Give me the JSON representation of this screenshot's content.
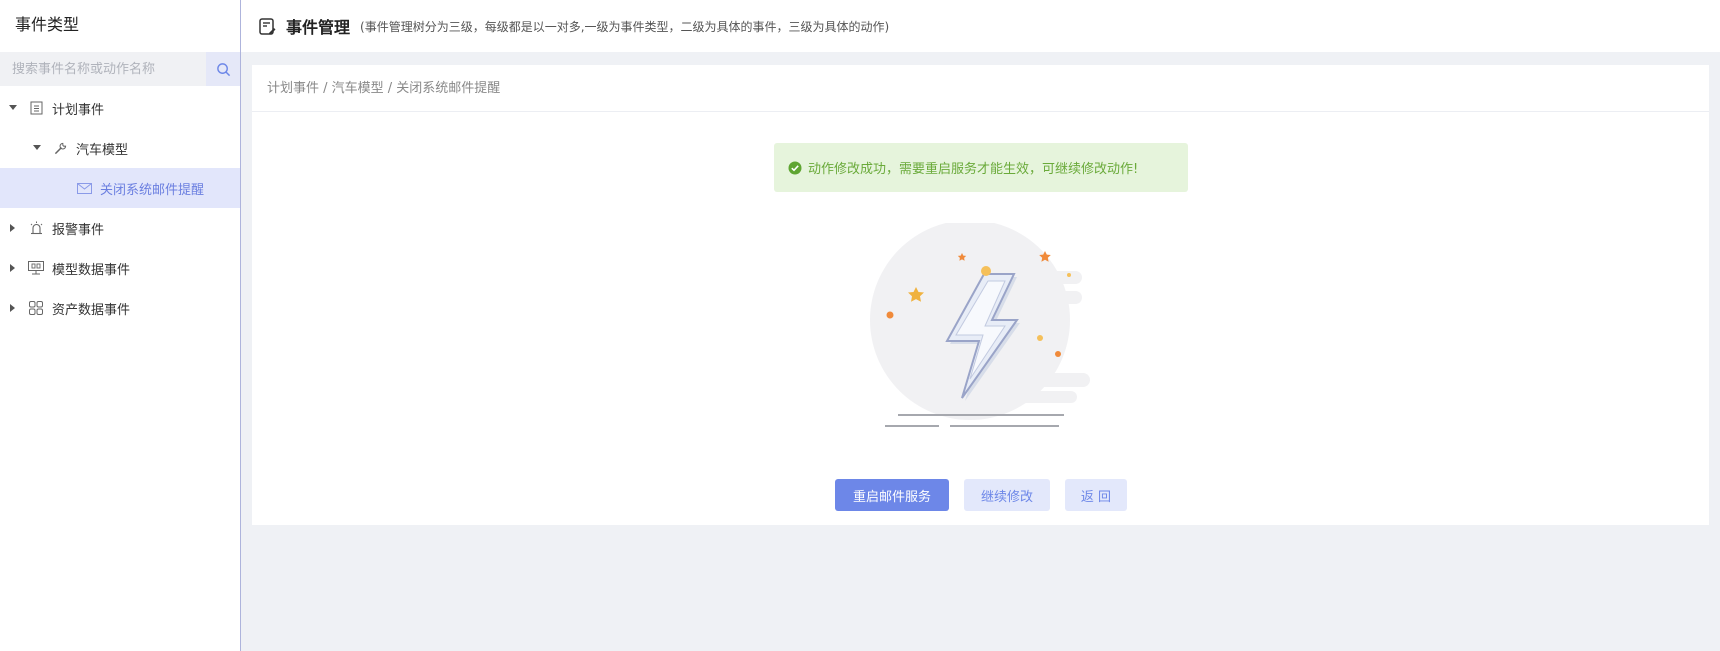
{
  "sidebar": {
    "title": "事件类型",
    "search_placeholder": "搜索事件名称或动作名称",
    "tree": [
      {
        "label": "计划事件",
        "expanded": true,
        "icon": "document-icon"
      },
      {
        "label": "汽车模型",
        "expanded": true,
        "icon": "wrench-icon"
      },
      {
        "label": "关闭系统邮件提醒",
        "selected": true,
        "icon": "mail-icon"
      },
      {
        "label": "报警事件",
        "expanded": false,
        "icon": "alarm-icon"
      },
      {
        "label": "模型数据事件",
        "expanded": false,
        "icon": "monitor-icon"
      },
      {
        "label": "资产数据事件",
        "expanded": false,
        "icon": "grid-icon"
      }
    ]
  },
  "header": {
    "title": "事件管理",
    "description": "(事件管理树分为三级，每级都是以一对多,一级为事件类型，二级为具体的事件，三级为具体的动作)"
  },
  "breadcrumb": "计划事件 / 汽车模型 / 关闭系统邮件提醒",
  "alert": {
    "message": "动作修改成功，需要重启服务才能生效，可继续修改动作!",
    "color": "#6aaa3a"
  },
  "actions": {
    "restart_label": "重启邮件服务",
    "continue_label": "继续修改",
    "back_label": "返 回"
  },
  "colors": {
    "accent": "#6d87e8",
    "selected_bg": "#e2e6fb",
    "success_bg": "#e6f4dc"
  }
}
